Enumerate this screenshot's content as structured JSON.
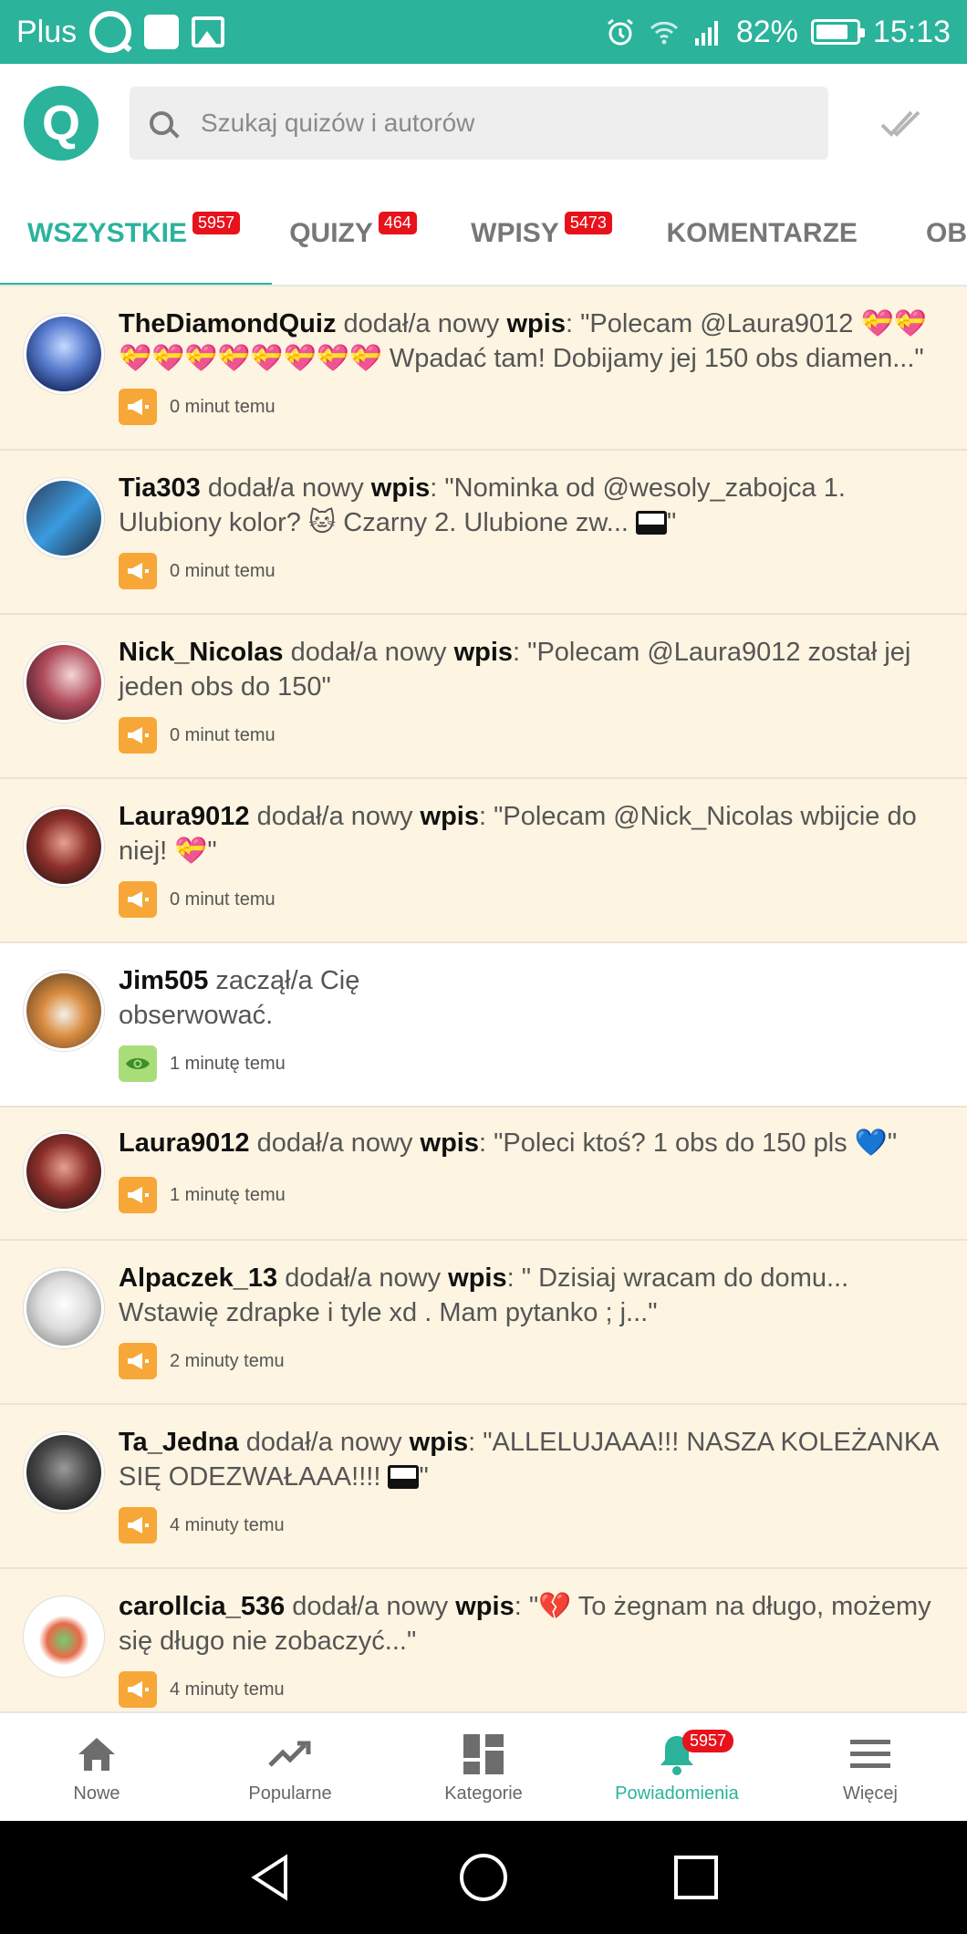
{
  "statusbar": {
    "carrier": "Plus",
    "battery_percent": "82%",
    "time": "15:13"
  },
  "search": {
    "placeholder": "Szukaj quizów i autorów"
  },
  "tabs": [
    {
      "label": "WSZYSTKIE",
      "badge": "5957"
    },
    {
      "label": "QUIZY",
      "badge": "464"
    },
    {
      "label": "WPISY",
      "badge": "5473"
    },
    {
      "label": "KOMENTARZE",
      "badge": ""
    },
    {
      "label": "OB",
      "badge": ""
    }
  ],
  "feed": [
    {
      "user": "TheDiamondQuiz",
      "action": "dodał/a nowy",
      "kind": "wpis",
      "quote": ": \"Polecam @Laura9012 ",
      "quote2": " Wpadać tam! Dobijamy jej 150 obs diamen...\"",
      "time": "0 minut temu"
    },
    {
      "user": "Tia303",
      "action": "dodał/a nowy",
      "kind": "wpis",
      "quote": ": \"Nominka od @wesoly_zabojca 1. Ulubiony kolor? ",
      "quote2": " Czarny 2. Ulubione zw... ",
      "quote3": "\"",
      "time": "0 minut temu"
    },
    {
      "user": "Nick_Nicolas",
      "action": "dodał/a nowy",
      "kind": "wpis",
      "quote": ": \"Polecam @Laura9012 został jej jeden obs do 150\"",
      "time": "0 minut temu"
    },
    {
      "user": "Laura9012",
      "action": "dodał/a nowy",
      "kind": "wpis",
      "quote": ": \"Polecam @Nick_Nicolas wbijcie do niej! ",
      "quote2": "\"",
      "time": "0 minut temu"
    },
    {
      "user": "Jim505",
      "action": "zaczął/a Cię obserwować.",
      "time": "1 minutę temu"
    },
    {
      "user": "Laura9012",
      "action": "dodał/a nowy",
      "kind": "wpis",
      "quote": ": \"Poleci ktoś? 1 obs do 150 pls ",
      "quote2": "\"",
      "time": "1 minutę temu"
    },
    {
      "user": "Alpaczek_13",
      "action": "dodał/a nowy",
      "kind": "wpis",
      "quote": ": \" Dzisiaj wracam do domu... Wstawię zdrapke i tyle xd . Mam pytanko ; j...\"",
      "time": "2 minuty temu"
    },
    {
      "user": "Ta_Jedna",
      "action": "dodał/a nowy",
      "kind": "wpis",
      "quote": ": \"ALLELUJAAA!!! NASZA KOLEŻANKA SIĘ ODEZWAŁAAA!!!! ",
      "quote2": "\"",
      "time": "4 minuty temu"
    },
    {
      "user": "carollcia_536",
      "action": "dodał/a nowy",
      "kind": "wpis",
      "quote": ": \"",
      "quote2": " To żegnam na długo, możemy się długo nie zobaczyć...\"",
      "time": "4 minuty temu"
    }
  ],
  "bottomnav": [
    {
      "label": "Nowe",
      "icon": "home-icon"
    },
    {
      "label": "Popularne",
      "icon": "trending-icon"
    },
    {
      "label": "Kategorie",
      "icon": "grid-icon"
    },
    {
      "label": "Powiadomienia",
      "icon": "bell-icon",
      "badge": "5957"
    },
    {
      "label": "Więcej",
      "icon": "menu-icon"
    }
  ],
  "colors": {
    "brand": "#2bb39c",
    "badge": "#e8121b",
    "unread_bg": "#fdf4e1",
    "post_icon": "#f7a738",
    "follow_icon": "#a9dd79"
  }
}
